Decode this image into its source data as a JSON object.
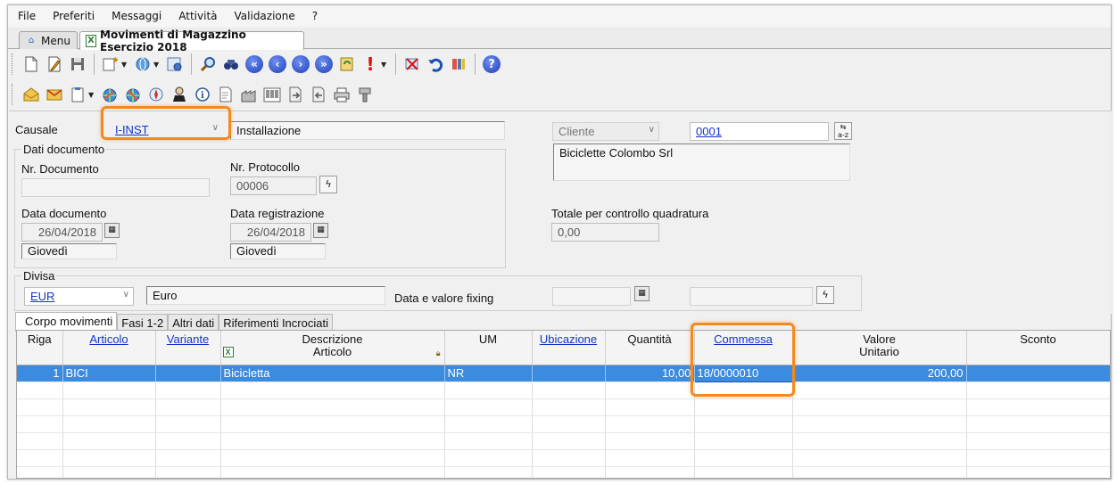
{
  "menu": [
    "File",
    "Preferiti",
    "Messaggi",
    "Attività",
    "Validazione",
    "?"
  ],
  "window_tabs": {
    "menu": "Menu",
    "active": "Movimenti di Magazzino Esercizio 2018"
  },
  "toolbar1_icons": [
    "new-icon",
    "edit-icon",
    "save-icon",
    "insert-icon",
    "view-icon",
    "settings-icon",
    "search-icon",
    "binoculars-icon",
    "first-icon",
    "prev-icon",
    "next-icon",
    "last-icon",
    "refresh-icon",
    "alert-icon",
    "delete-icon",
    "undo-icon",
    "tools-icon",
    "help-icon"
  ],
  "toolbar2_icons": [
    "mail-open-icon",
    "mail-icon",
    "clipboard-icon",
    "web-icon",
    "web-alt-icon",
    "compass-icon",
    "user-icon",
    "info-icon",
    "document-icon",
    "factory-icon",
    "barcode-icon",
    "export-icon",
    "import-icon",
    "print-icon",
    "scanner-icon"
  ],
  "form": {
    "causale_label": "Causale",
    "causale_code": "I-INST",
    "causale_desc": "Installazione",
    "cliente_type": "Cliente",
    "cliente_code": "0001",
    "cliente_name": "Biciclette Colombo Srl",
    "dati_documento": "Dati documento",
    "nr_documento_label": "Nr. Documento",
    "nr_documento": "",
    "nr_protocollo_label": "Nr. Protocollo",
    "nr_protocollo": "00006",
    "data_documento_label": "Data documento",
    "data_documento": "26/04/2018",
    "data_documento_day": "Giovedì",
    "data_registrazione_label": "Data registrazione",
    "data_registrazione": "26/04/2018",
    "data_registrazione_day": "Giovedì",
    "totale_label": "Totale per controllo quadratura",
    "totale": "0,00",
    "divisa_label": "Divisa",
    "divisa_code": "EUR",
    "divisa_desc": "Euro",
    "fixing_label": "Data e valore fixing"
  },
  "panel_tabs": [
    "Corpo movimenti",
    "Fasi 1-2",
    "Altri dati",
    "Riferimenti Incrociati"
  ],
  "grid": {
    "headers": {
      "riga": "Riga",
      "articolo": "Articolo",
      "variante": "Variante",
      "descrizione_1": "Descrizione",
      "descrizione_2": "Articolo",
      "um": "UM",
      "ubicazione": "Ubicazione",
      "quantita": "Quantità",
      "commessa": "Commessa",
      "valore_1": "Valore",
      "valore_2": "Unitario",
      "sconto": "Sconto"
    },
    "row": {
      "riga": "1",
      "articolo": "BICI",
      "variante": "",
      "descrizione": "Bicicletta",
      "um": "NR",
      "ubicazione": "",
      "quantita": "10,00",
      "commessa": "18/0000010",
      "valore": "200,00",
      "sconto": ""
    }
  },
  "colors": {
    "highlight": "#f28a1d",
    "selection": "#3b8be0",
    "link": "#1133cc"
  }
}
